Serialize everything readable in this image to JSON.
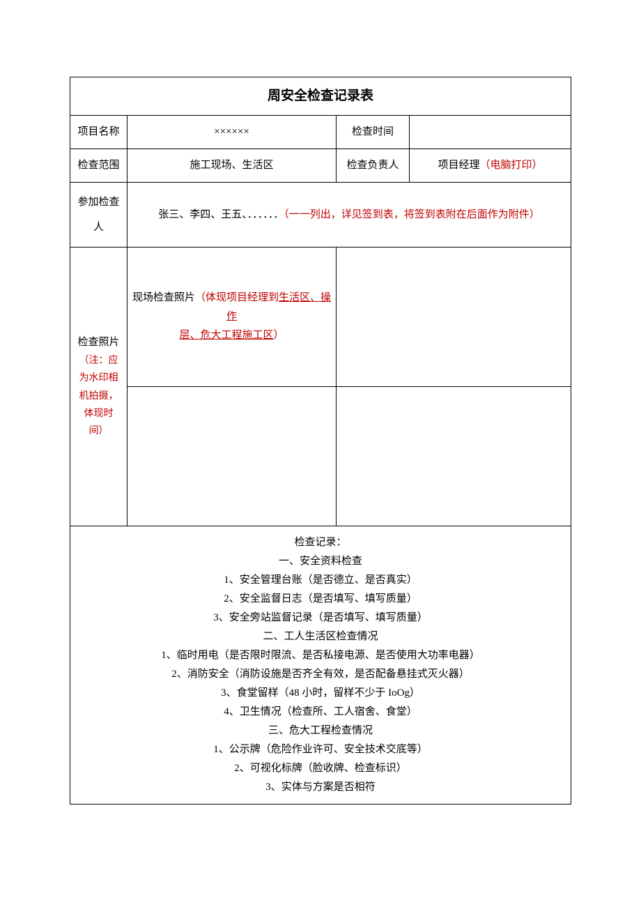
{
  "title": "周安全检查记录表",
  "row1": {
    "label_project": "项目名称",
    "project_value": "××××××",
    "label_time": "检查时间",
    "time_value": ""
  },
  "row2": {
    "label_scope": "检查范围",
    "scope_value": "施工现场、生活区",
    "label_resp": "检查负责人",
    "resp_prefix": "项目经理",
    "resp_note": "（电脑打印）"
  },
  "row3": {
    "label_participants": "参加检查人",
    "participants_prefix": "张三、李四、王五、．．．．．．",
    "participants_note": "（一一列出，详见签到表，将签到表附在后面作为附件）"
  },
  "photo": {
    "label_main": "检查照片",
    "label_note1": "（注：应",
    "label_note2": "为水印相",
    "label_note3": "机拍摄，",
    "label_note4": "体现时",
    "label_note5": "间）",
    "desc_prefix": "现场检查照片",
    "desc_red1": "（体现项目经理到",
    "desc_u1": "生活区、操作",
    "desc_u2": "层、危大工程施工区",
    "desc_red2": "）"
  },
  "record": {
    "heading": "检查记录：",
    "s1": "一、安全资料检查",
    "s1_1": "1、安全管理台账（是否德立、是否真实）",
    "s1_2": "2、安全监督日志（是否填写、填写质量）",
    "s1_3": "3、安全旁站监督记录（是否填写、填写质量）",
    "s2": "二、工人生活区检查情况",
    "s2_1": "1、临时用电（是否限时限流、是否私接电源、是否使用大功率电器）",
    "s2_2": "2、消防安全（消防设施是否齐全有效，是否配备悬挂式灭火器）",
    "s2_3": "3、食堂留样（48 小时，留样不少于 IoOg）",
    "s2_4": "4、卫生情况（检查所、工人宿舍、食堂）",
    "s3": "三、危大工程检查情况",
    "s3_1": "1、公示牌（危险作业许可、安全技术交底等）",
    "s3_2": "2、可视化标牌（脸收牌、检查标识）",
    "s3_3": "3、实体与方案是否相符"
  }
}
